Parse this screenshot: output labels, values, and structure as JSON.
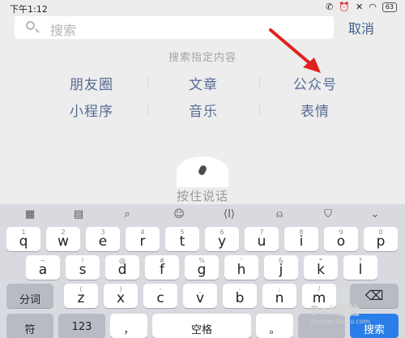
{
  "status_bar": {
    "time": "下午1:12",
    "battery": "63"
  },
  "search": {
    "placeholder": "搜索",
    "cancel_label": "取消"
  },
  "section_title": "搜索指定内容",
  "categories": [
    {
      "label": "朋友圈"
    },
    {
      "label": "文章"
    },
    {
      "label": "公众号"
    },
    {
      "label": "小程序"
    },
    {
      "label": "音乐"
    },
    {
      "label": "表情"
    }
  ],
  "voice": {
    "label": "按住说话"
  },
  "keyboard": {
    "toolbar_icons": [
      "grid-icon",
      "keyboard-icon",
      "search-icon",
      "emoji-icon",
      "cursor-icon",
      "microphone-icon",
      "shield-icon",
      "collapse-icon"
    ],
    "row1": [
      {
        "hint": "1",
        "ch": "q"
      },
      {
        "hint": "2",
        "ch": "w"
      },
      {
        "hint": "3",
        "ch": "e"
      },
      {
        "hint": "4",
        "ch": "r"
      },
      {
        "hint": "5",
        "ch": "t"
      },
      {
        "hint": "6",
        "ch": "y"
      },
      {
        "hint": "7",
        "ch": "u"
      },
      {
        "hint": "8",
        "ch": "i"
      },
      {
        "hint": "9",
        "ch": "o"
      },
      {
        "hint": "0",
        "ch": "p"
      }
    ],
    "row2": [
      {
        "hint": "~",
        "ch": "a"
      },
      {
        "hint": "!",
        "ch": "s"
      },
      {
        "hint": "@",
        "ch": "d"
      },
      {
        "hint": "#",
        "ch": "f"
      },
      {
        "hint": "%",
        "ch": "g"
      },
      {
        "hint": "'",
        "ch": "h"
      },
      {
        "hint": "&",
        "ch": "j"
      },
      {
        "hint": "*",
        "ch": "k"
      },
      {
        "hint": "?",
        "ch": "l"
      }
    ],
    "row3_left": "分词",
    "row3": [
      {
        "hint": "(",
        "ch": "z"
      },
      {
        "hint": ")",
        "ch": "x"
      },
      {
        "hint": "-",
        "ch": "c"
      },
      {
        "hint": "_",
        "ch": "v"
      },
      {
        "hint": ":",
        "ch": "b"
      },
      {
        "hint": ";",
        "ch": "n"
      },
      {
        "hint": "/",
        "ch": "m"
      }
    ],
    "row4": {
      "symbols": "符",
      "numbers": "123",
      "comma": "，",
      "space": "空格",
      "period": "。",
      "search": "搜索"
    }
  },
  "watermark": {
    "brand": "Bai经验",
    "sub": "jingyan.baidu.com"
  },
  "colors": {
    "accent": "#576b95",
    "arrow": "#e0221f",
    "search_key": "#2a7ee8"
  }
}
